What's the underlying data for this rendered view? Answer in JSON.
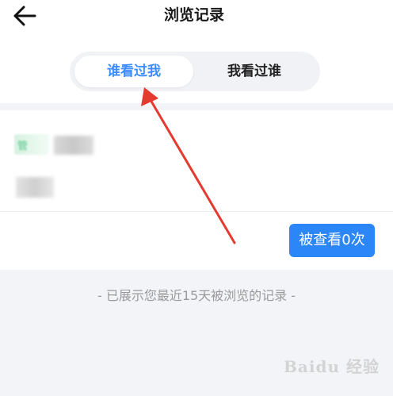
{
  "header": {
    "title": "浏览记录",
    "back_icon": "back-arrow-icon"
  },
  "tabs": [
    {
      "label": "谁看过我",
      "active": true
    },
    {
      "label": "我看过谁",
      "active": false
    }
  ],
  "visitors": {
    "tag_text": "管"
  },
  "count_button": {
    "label": "被查看0次"
  },
  "footer": {
    "note": "- 已展示您最近15天被浏览的记录 -"
  },
  "watermark": {
    "text": "Baidu 经验"
  },
  "colors": {
    "accent": "#3b8cff",
    "button": "#2b86f7",
    "annotation_arrow": "#e53a2f"
  }
}
